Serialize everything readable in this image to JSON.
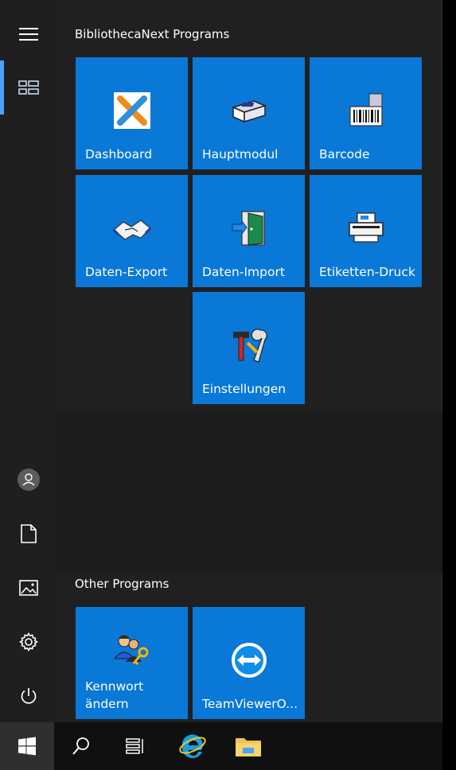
{
  "groups": [
    {
      "title": "BibliothecaNext Programs",
      "tiles": [
        {
          "label": "Dashboard",
          "icon": "dashboard-x-icon"
        },
        {
          "label": "Hauptmodul",
          "icon": "printer-box-icon"
        },
        {
          "label": "Barcode",
          "icon": "barcode-scanner-icon"
        },
        {
          "label": "Daten-Export",
          "icon": "handshake-icon"
        },
        {
          "label": "Daten-Import",
          "icon": "door-arrow-icon"
        },
        {
          "label": "Etiketten-Druck",
          "icon": "label-printer-icon"
        },
        {
          "label": "Einstellungen",
          "icon": "tools-icon"
        }
      ]
    },
    {
      "title": "Other Programs",
      "tiles": [
        {
          "label": "Kennwort ändern",
          "icon": "users-key-icon"
        },
        {
          "label": "TeamViewerO...",
          "icon": "teamviewer-icon"
        }
      ]
    }
  ],
  "rail": [
    "hamburger-menu-icon",
    "all-apps-grid-icon",
    "user-avatar-icon",
    "documents-icon",
    "pictures-icon",
    "settings-gear-icon",
    "power-icon"
  ],
  "taskbar": [
    "windows-start-icon",
    "search-icon",
    "task-view-icon",
    "internet-explorer-icon",
    "file-explorer-icon"
  ],
  "colors": {
    "tile": "#0a78d7",
    "menu_bg": "#202020",
    "accent": "#4aa3ff"
  }
}
